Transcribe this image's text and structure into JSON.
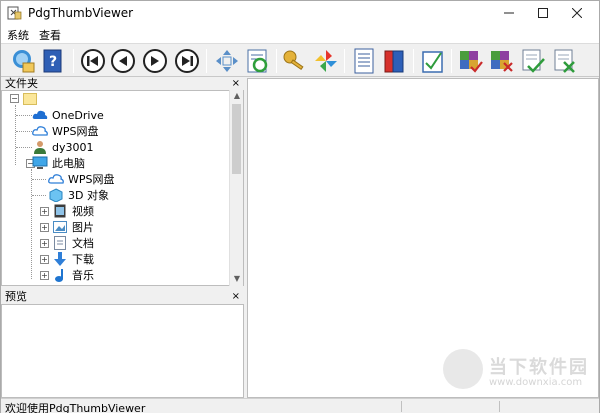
{
  "window": {
    "title": "PdgThumbViewer"
  },
  "menu": {
    "items": [
      "系统",
      "查看"
    ]
  },
  "toolbar": {
    "buttons": [
      "search-folder-icon",
      "help-book-icon",
      "first-page-icon",
      "previous-page-icon",
      "next-page-icon",
      "last-page-icon",
      "move-arrows-icon",
      "refresh-sheet-icon",
      "key-icon",
      "pinwheel-icon",
      "document-icon",
      "books-icon",
      "check-chart-icon",
      "puzzle-check-icon",
      "puzzle-cross-icon",
      "sheet-check-icon",
      "sheet-cross-icon"
    ]
  },
  "folder_pane": {
    "header": "文件夹",
    "tree": [
      {
        "label": "",
        "icon": "folder-icon"
      },
      {
        "label": "OneDrive",
        "icon": "cloud-icon"
      },
      {
        "label": "WPS网盘",
        "icon": "cloud-outline-icon"
      },
      {
        "label": "dy3001",
        "icon": "user-icon"
      },
      {
        "label": "此电脑",
        "icon": "computer-icon"
      },
      {
        "label": "WPS网盘",
        "icon": "cloud-outline-icon"
      },
      {
        "label": "3D 对象",
        "icon": "cube-icon"
      },
      {
        "label": "视频",
        "icon": "video-icon"
      },
      {
        "label": "图片",
        "icon": "picture-icon"
      },
      {
        "label": "文档",
        "icon": "document-icon"
      },
      {
        "label": "下载",
        "icon": "download-icon"
      },
      {
        "label": "音乐",
        "icon": "music-icon"
      }
    ]
  },
  "preview_pane": {
    "header": "预览"
  },
  "status": {
    "text": "欢迎使用PdgThumbViewer"
  },
  "watermark": {
    "text": "当下软件园",
    "url": "www.downxia.com"
  }
}
